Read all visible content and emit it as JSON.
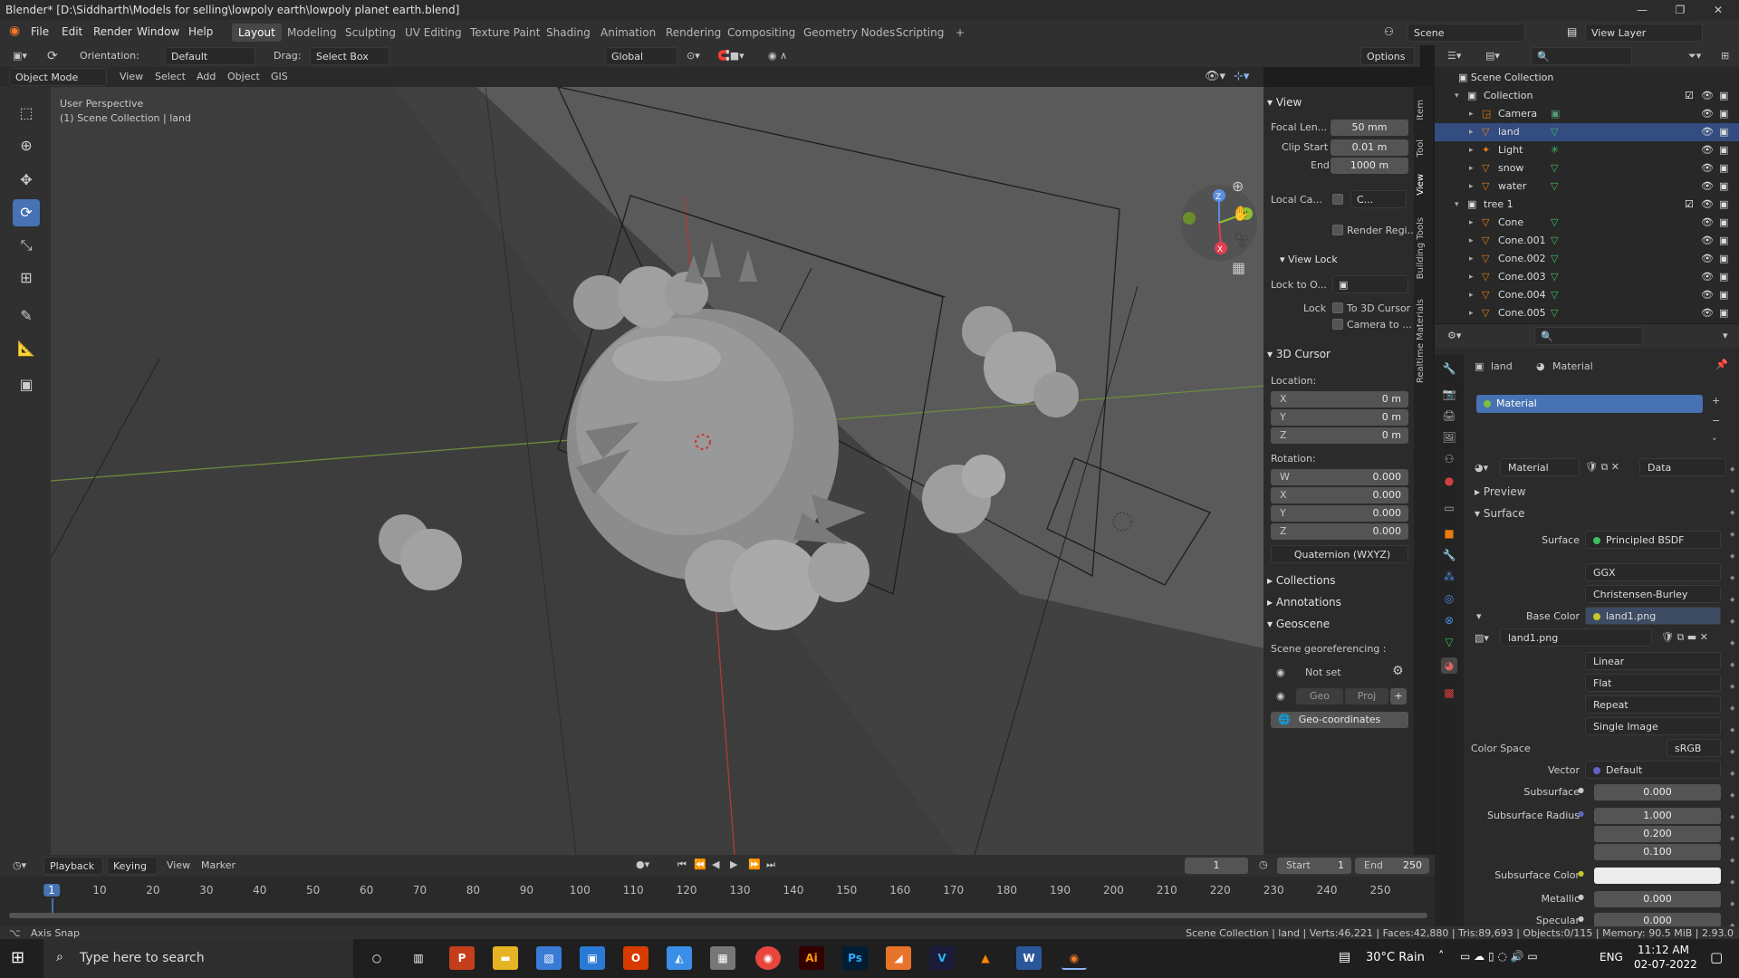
{
  "window": {
    "title": "Blender* [D:\\Siddharth\\Models for selling\\lowpoly earth\\lowpoly planet earth.blend]"
  },
  "menu": [
    "File",
    "Edit",
    "Render",
    "Window",
    "Help"
  ],
  "workspaces": [
    "Layout",
    "Modeling",
    "Sculpting",
    "UV Editing",
    "Texture Paint",
    "Shading",
    "Animation",
    "Rendering",
    "Compositing",
    "Geometry Nodes",
    "Scripting"
  ],
  "scene": {
    "name": "Scene",
    "view_layer": "View Layer"
  },
  "viewport_header": {
    "orientation_label": "Orientation:",
    "orientation": "Default",
    "drag_label": "Drag:",
    "drag": "Select Box",
    "transform": "Global",
    "options": "Options",
    "mode": "Object Mode",
    "menus": [
      "View",
      "Select",
      "Add",
      "Object",
      "GIS"
    ]
  },
  "viewport": {
    "perspective": "User Perspective",
    "collection": "(1) Scene Collection | land"
  },
  "npanel": {
    "view_title": "View",
    "focal_label": "Focal Len...",
    "focal": "50 mm",
    "clip_start_label": "Clip Start",
    "clip_start": "0.01 m",
    "clip_end_label": "End",
    "clip_end": "1000 m",
    "local_camera_label": "Local Ca...",
    "local_camera_value": "C...",
    "render_region_label": "Render Regi...",
    "view_lock_title": "View Lock",
    "lock_to_label": "Lock to O...",
    "lock_label": "Lock",
    "to_3d_cursor": "To 3D Cursor",
    "camera_to": "Camera to ...",
    "cursor_title": "3D Cursor",
    "location_label": "Location:",
    "loc": [
      {
        "k": "X",
        "v": "0 m"
      },
      {
        "k": "Y",
        "v": "0 m"
      },
      {
        "k": "Z",
        "v": "0 m"
      }
    ],
    "rotation_label": "Rotation:",
    "rot": [
      {
        "k": "W",
        "v": "0.000"
      },
      {
        "k": "X",
        "v": "0.000"
      },
      {
        "k": "Y",
        "v": "0.000"
      },
      {
        "k": "Z",
        "v": "0.000"
      }
    ],
    "rotation_mode": "Quaternion (WXYZ)",
    "collections": "Collections",
    "annotations": "Annotations",
    "geoscene": "Geoscene",
    "georef_label": "Scene georeferencing :",
    "not_set": "Not set",
    "geo": "Geo",
    "proj": "Proj",
    "geo_coordinates": "Geo-coordinates",
    "tabs": [
      "Item",
      "Tool",
      "View",
      "Building Tools",
      "Realtime Materials"
    ]
  },
  "outliner": {
    "root": "Scene Collection",
    "rows": [
      {
        "name": "Collection",
        "indent": 0,
        "type": "collection"
      },
      {
        "name": "Camera",
        "indent": 1,
        "type": "camera"
      },
      {
        "name": "land",
        "indent": 1,
        "type": "mesh"
      },
      {
        "name": "Light",
        "indent": 1,
        "type": "light"
      },
      {
        "name": "snow",
        "indent": 1,
        "type": "mesh"
      },
      {
        "name": "water",
        "indent": 1,
        "type": "mesh"
      },
      {
        "name": "tree 1",
        "indent": 0,
        "type": "collection"
      },
      {
        "name": "Cone",
        "indent": 1,
        "type": "mesh"
      },
      {
        "name": "Cone.001",
        "indent": 1,
        "type": "mesh"
      },
      {
        "name": "Cone.002",
        "indent": 1,
        "type": "mesh"
      },
      {
        "name": "Cone.003",
        "indent": 1,
        "type": "mesh"
      },
      {
        "name": "Cone.004",
        "indent": 1,
        "type": "mesh"
      },
      {
        "name": "Cone.005",
        "indent": 1,
        "type": "mesh"
      }
    ]
  },
  "properties": {
    "breadcrumb_object": "land",
    "breadcrumb_material": "Material",
    "slot": "Material",
    "material_name": "Material",
    "link": "Data",
    "preview": "Preview",
    "surface_section": "Surface",
    "surface_label": "Surface",
    "surface": "Principled BSDF",
    "distribution": "GGX",
    "subsurface_method": "Christensen-Burley",
    "base_color_label": "Base Color",
    "base_color": "land1.png",
    "image": "land1.png",
    "interpolation": "Linear",
    "projection": "Flat",
    "extension": "Repeat",
    "source": "Single Image",
    "color_space_label": "Color Space",
    "color_space": "sRGB",
    "vector_label": "Vector",
    "vector": "Default",
    "subsurface_label": "Subsurface",
    "subsurface": "0.000",
    "subsurface_radius_label": "Subsurface Radius",
    "subsurface_radius": [
      "1.000",
      "0.200",
      "0.100"
    ],
    "subsurface_color_label": "Subsurface Color",
    "metallic_label": "Metallic",
    "metallic": "0.000",
    "specular_label": "Specular",
    "specular": "0.000"
  },
  "timeline": {
    "menus": [
      "Playback",
      "Keying",
      "View",
      "Marker"
    ],
    "current_frame": "1",
    "start_label": "Start",
    "start": "1",
    "end_label": "End",
    "end": "250",
    "ticks": [
      "1",
      "10",
      "20",
      "30",
      "40",
      "50",
      "60",
      "70",
      "80",
      "90",
      "100",
      "110",
      "120",
      "130",
      "140",
      "150",
      "160",
      "170",
      "180",
      "190",
      "200",
      "210",
      "220",
      "230",
      "240",
      "250"
    ]
  },
  "statusbar": {
    "left": "Axis Snap",
    "right": "Scene Collection | land | Verts:46,221 | Faces:42,880 | Tris:89,693 | Objects:0/115 | Memory: 90.5 MiB | 2.93.0"
  },
  "taskbar": {
    "search_placeholder": "Type here to search",
    "weather": "30°C  Rain",
    "lang": "ENG",
    "time": "11:12 AM",
    "date": "02-07-2022"
  },
  "colors": {
    "accent": "#4772b3",
    "selected_row": "#334d80",
    "orange": "#e87d0d",
    "blender_orange": "#f5792a"
  }
}
